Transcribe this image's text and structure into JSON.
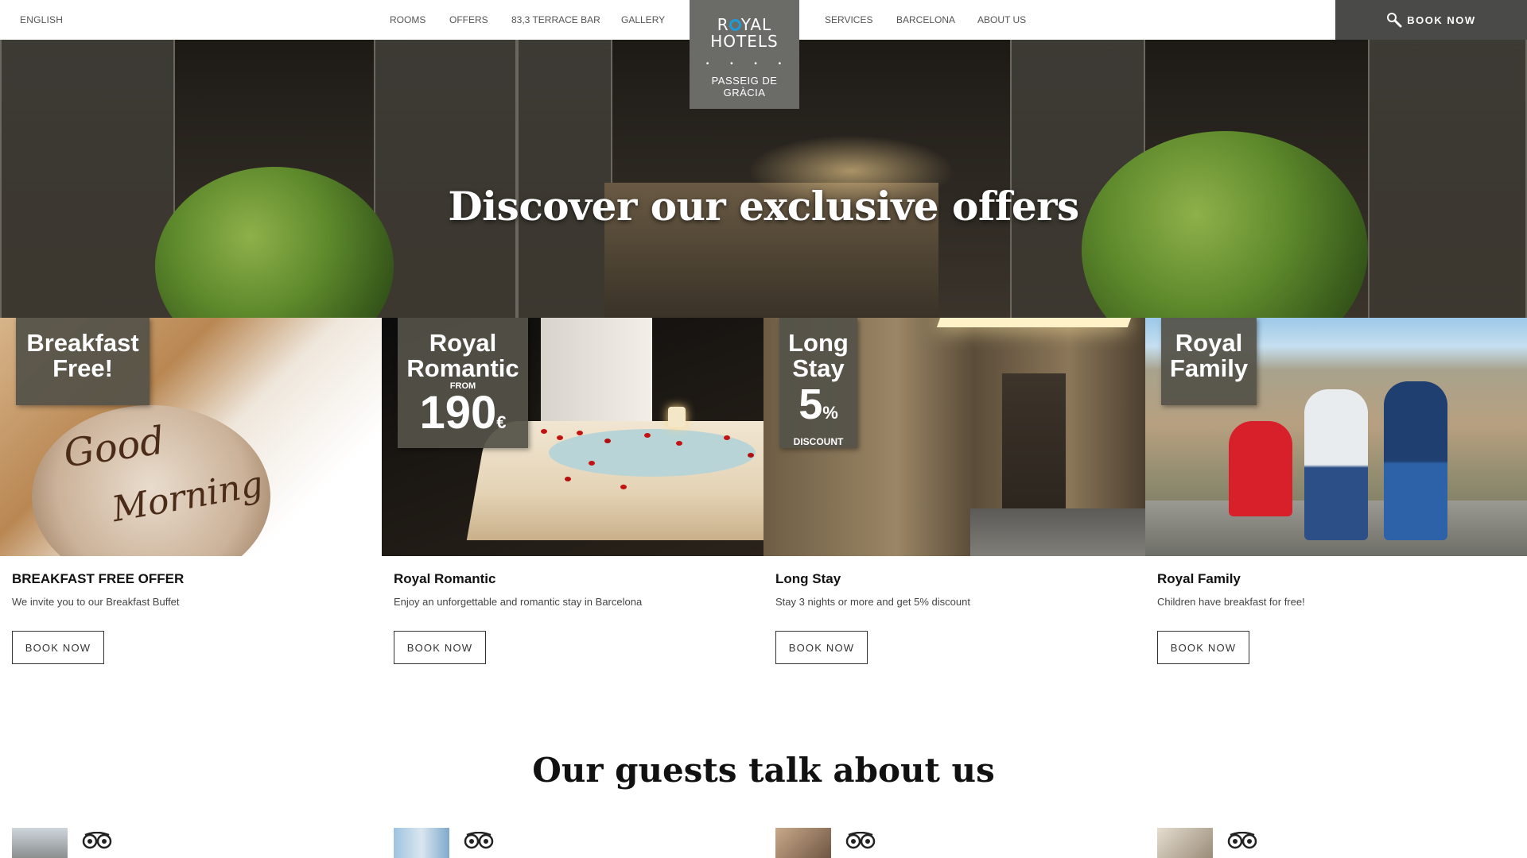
{
  "header": {
    "language": "ENGLISH",
    "nav_left": [
      "ROOMS",
      "OFFERS",
      "83,3 TERRACE BAR",
      "GALLERY"
    ],
    "nav_right": [
      "SERVICES",
      "BARCELONA",
      "ABOUT US"
    ],
    "book_now": "BOOK NOW"
  },
  "logo": {
    "line1_a": "R",
    "line1_b": "YAL",
    "line2": "HOTELS",
    "dots": "• • • •",
    "place_line1": "PASSEIG DE",
    "place_line2": "GRÀCIA",
    "accent_color": "#1f9ad6"
  },
  "hero": {
    "heading": "Discover our exclusive offers"
  },
  "offers": [
    {
      "tag_line1": "Breakfast",
      "tag_line2": "Free!",
      "title": "BREAKFAST FREE OFFER",
      "description": "We invite you to our Breakfast Buffet",
      "button": "BOOK NOW",
      "image_text_1": "Good",
      "image_text_2": "Morning"
    },
    {
      "tag_line1": "Royal",
      "tag_line2": "Romantic",
      "tag_from": "FROM",
      "tag_price": "190",
      "tag_currency": "€",
      "title": "Royal Romantic",
      "description": "Enjoy an unforgettable and romantic stay in Barcelona",
      "button": "BOOK NOW"
    },
    {
      "tag_line1": "Long",
      "tag_line2": "Stay",
      "tag_number": "5",
      "tag_percent": "%",
      "tag_discount": "DISCOUNT",
      "title": "Long Stay",
      "description": "Stay 3 nights or more and get 5% discount",
      "button": "BOOK NOW"
    },
    {
      "tag_line1": "Royal",
      "tag_line2": "Family",
      "title": "Royal Family",
      "description": "Children have breakfast for free!",
      "button": "BOOK NOW"
    }
  ],
  "guests": {
    "heading": "Our guests talk about us",
    "review_icons": [
      "tripadvisor-owl-icon",
      "tripadvisor-owl-icon",
      "tripadvisor-owl-icon",
      "tripadvisor-owl-icon"
    ]
  }
}
